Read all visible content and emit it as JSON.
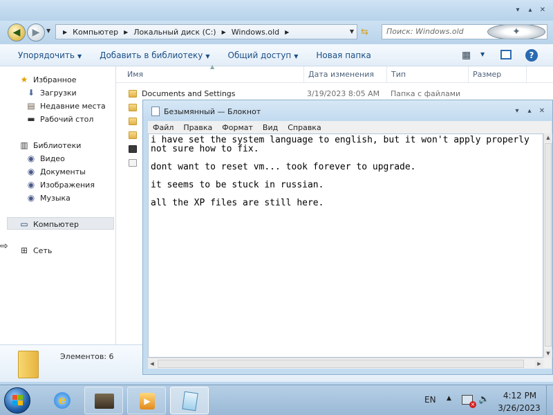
{
  "explorer": {
    "breadcrumbs": [
      "Компьютер",
      "Локальный диск (C:)",
      "Windows.old"
    ],
    "search_placeholder": "Поиск: Windows.old",
    "toolbar": {
      "organize": "Упорядочить",
      "add_to_library": "Добавить в библиотеку",
      "share": "Общий доступ",
      "new_folder": "Новая папка"
    },
    "nav": {
      "favorites": "Избранное",
      "downloads": "Загрузки",
      "recent": "Недавние места",
      "desktop": "Рабочий стол",
      "libraries": "Библиотеки",
      "video": "Видео",
      "documents": "Документы",
      "pictures": "Изображения",
      "music": "Музыка",
      "computer": "Компьютер",
      "network": "Сеть"
    },
    "columns": {
      "name": "Имя",
      "date": "Дата изменения",
      "type": "Тип",
      "size": "Размер"
    },
    "files": [
      {
        "name": "Documents and Settings",
        "date": "3/19/2023 8:05 AM",
        "type": "Папка с файлами",
        "size": ""
      }
    ],
    "details_count": "Элементов: 6"
  },
  "notepad": {
    "title": "Безымянный — Блокнот",
    "menu": [
      "Файл",
      "Правка",
      "Формат",
      "Вид",
      "Справка"
    ],
    "lines": [
      "i have set the system language to english, but it won't apply properly",
      "not sure how to fix.",
      "",
      "dont want to reset vm... took forever to upgrade.",
      "",
      "it seems to be stuck in russian.",
      "",
      "all the XP files are still here."
    ]
  },
  "taskbar": {
    "lang": "EN",
    "time": "4:12 PM",
    "date": "3/26/2023"
  },
  "colors": {
    "accent": "#1a4f86",
    "window_frame": "#bcd6ec",
    "taskbar": "#a8c6e0"
  }
}
